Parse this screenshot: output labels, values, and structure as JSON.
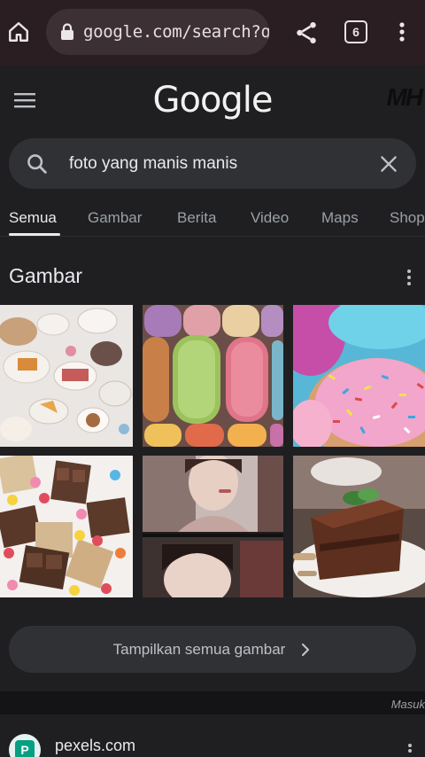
{
  "browser": {
    "url": "google.com/search?q=",
    "tab_count": "6"
  },
  "header": {
    "logo_text": "Google",
    "watermark": "MH"
  },
  "search": {
    "query": "foto yang manis manis"
  },
  "tabs": [
    {
      "label": "Semua",
      "active": true
    },
    {
      "label": "Gambar"
    },
    {
      "label": "Berita"
    },
    {
      "label": "Video"
    },
    {
      "label": "Maps"
    },
    {
      "label": "Shop"
    }
  ],
  "images_section": {
    "title": "Gambar",
    "images": [
      {
        "name": "desserts-table"
      },
      {
        "name": "macarons"
      },
      {
        "name": "sprinkle-donut"
      },
      {
        "name": "chocolate-candies"
      },
      {
        "name": "girl-selfie-collage"
      },
      {
        "name": "chocolate-cake-slice"
      }
    ],
    "show_all_label": "Tampilkan semua gambar"
  },
  "footer": {
    "masuk": "Masuk"
  },
  "result": {
    "site": "pexels.com",
    "favicon_letter": "P"
  },
  "colors": {
    "background": "#1f1f21",
    "chrome_bar": "#2a1e22",
    "pill": "#303134",
    "text_primary": "#e8eaed",
    "text_secondary": "#9aa0a6"
  }
}
